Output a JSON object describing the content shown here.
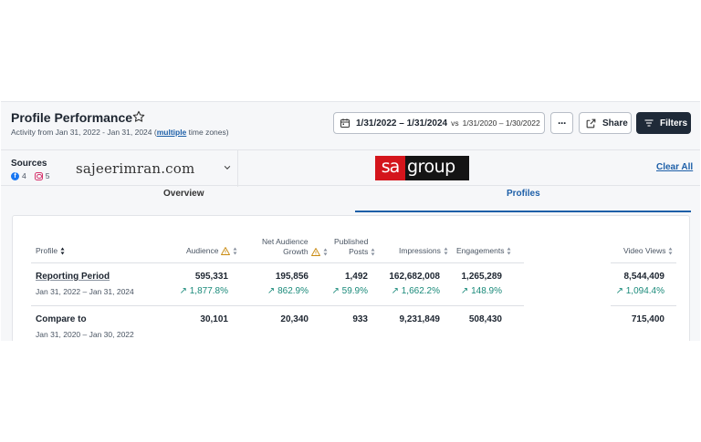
{
  "header": {
    "title": "Profile Performance",
    "activity_prefix": "Activity from Jan 31, 2022 - Jan 31, 2024 (",
    "activity_link": "multiple",
    "activity_suffix": " time zones)",
    "date_range": "1/31/2022 – 1/31/2024",
    "vs_label": "vs",
    "compare_range": "1/31/2020 – 1/30/2022",
    "share_label": "Share",
    "filters_label": "Filters",
    "more_label": "···"
  },
  "sources": {
    "label": "Sources",
    "facebook_count": "4",
    "instagram_count": "5",
    "site_name": "sajeerimran.com",
    "brand_left": "sa",
    "brand_right": "group",
    "clear_all": "Clear All",
    "brand_colors": {
      "red": "#d4151c",
      "black": "#141414"
    }
  },
  "tabs": [
    {
      "label": "Overview",
      "active": false
    },
    {
      "label": "Profiles",
      "active": true
    }
  ],
  "table": {
    "columns": {
      "profile": "Profile",
      "audience": "Audience",
      "net_audience_l1": "Net Audience",
      "net_audience_l2": "Growth",
      "published_l1": "Published",
      "published_l2": "Posts",
      "impressions": "Impressions",
      "engagements": "Engagements",
      "video_views": "Video Views"
    },
    "rows": [
      {
        "name": "Reporting Period",
        "dates": "Jan 31, 2022 – Jan 31, 2024",
        "audience": "595,331",
        "audience_change": "↗ 1,877.8%",
        "net_growth": "195,856",
        "net_growth_change": "↗ 862.9%",
        "published": "1,492",
        "published_change": "↗ 59.9%",
        "impressions": "162,682,008",
        "impressions_change": "↗ 1,662.2%",
        "engagements": "1,265,289",
        "engagements_change": "↗ 148.9%",
        "video_views": "8,544,409",
        "video_views_change": "↗ 1,094.4%"
      },
      {
        "name": "Compare to",
        "dates": "Jan 31, 2020 – Jan 30, 2022",
        "audience": "30,101",
        "net_growth": "20,340",
        "published": "933",
        "impressions": "9,231,849",
        "engagements": "508,430",
        "video_views": "715,400"
      }
    ]
  },
  "colors": {
    "accent": "#1d5fa8",
    "positive": "#1a8a7a",
    "filters_bg": "#1f2a38"
  }
}
